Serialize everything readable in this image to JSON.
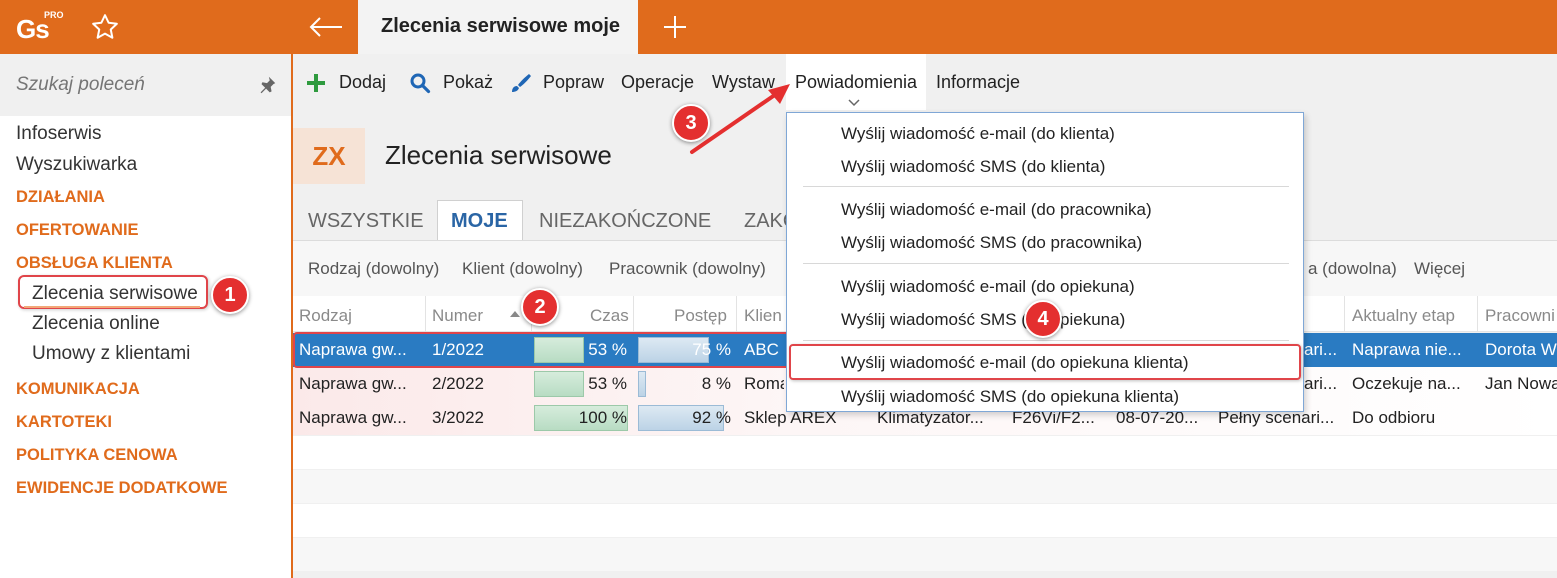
{
  "app": {
    "logo": "Gs",
    "logo_sup": "PRO",
    "window_tab": "Zlecenia serwisowe moje"
  },
  "sidebar": {
    "search_placeholder": "Szukaj poleceń",
    "items": [
      {
        "label": "Infoserwis"
      },
      {
        "label": "Wyszukiwarka"
      }
    ],
    "categories": {
      "dzialania": "DZIAŁANIA",
      "ofertowanie": "OFERTOWANIE",
      "obsluga": "OBSŁUGA KLIENTA",
      "komunikacja": "KOMUNIKACJA",
      "kartoteki": "KARTOTEKI",
      "polityka": "POLITYKA CENOWA",
      "ewidencje": "EWIDENCJE DODATKOWE"
    },
    "sub_items": [
      {
        "label": "Zlecenia serwisowe"
      },
      {
        "label": "Zlecenia online"
      },
      {
        "label": "Umowy z klientami"
      }
    ]
  },
  "toolbar": {
    "add": "Dodaj",
    "show": "Pokaż",
    "edit": "Popraw",
    "operations": "Operacje",
    "issue": "Wystaw",
    "notifications": "Powiadomienia",
    "info": "Informacje"
  },
  "page": {
    "badge": "ZX",
    "title": "Zlecenia serwisowe"
  },
  "view_tabs": [
    "WSZYSTKIE",
    "MOJE",
    "NIEZAKOŃCZONE",
    "ZAKO"
  ],
  "filters": {
    "type": "Rodzaj (dowolny)",
    "client": "Klient (dowolny)",
    "employee": "Pracownik (dowolny)",
    "stage": "a (dowolna)",
    "more": "Więcej"
  },
  "table": {
    "headers": {
      "type": "Rodzaj",
      "number": "Numer",
      "time": "Czas",
      "progress": "Postęp",
      "client": "Klien",
      "stage": "Aktualny etap",
      "employee": "Pracowni"
    },
    "rows": [
      {
        "type": "Naprawa gw...",
        "number": "1/2022",
        "time": "53 %",
        "time_fill": 0.53,
        "progress": "75 %",
        "progress_fill": 0.75,
        "client": "ABC S",
        "c5": "",
        "c6": "",
        "c7": "",
        "scenario": "ari...",
        "stage": "Naprawa nie...",
        "employee": "Dorota W"
      },
      {
        "type": "Naprawa gw...",
        "number": "2/2022",
        "time": "53 %",
        "time_fill": 0.53,
        "progress": "8 %",
        "progress_fill": 0.08,
        "client": "Roma",
        "c5": "",
        "c6": "",
        "c7": "",
        "scenario": "ari...",
        "stage": "Oczekuje na...",
        "employee": "Jan Nowa"
      },
      {
        "type": "Naprawa gw...",
        "number": "3/2022",
        "time": "100 %",
        "time_fill": 1.0,
        "progress": "92 %",
        "progress_fill": 0.92,
        "client": "Sklep AREX",
        "c5": "Klimatyzator...",
        "c6": "F26Vi/F2...",
        "c7": "08-07-20...",
        "scenario": "Pełny scenari...",
        "stage": "Do odbioru",
        "employee": ""
      }
    ]
  },
  "dropdown": {
    "items": [
      "Wyślij wiadomość e-mail (do klienta)",
      "Wyślij wiadomość SMS (do klienta)",
      "Wyślij wiadomość e-mail (do pracownika)",
      "Wyślij wiadomość SMS (do pracownika)",
      "Wyślij wiadomość e-mail (do opiekuna)",
      "Wyślij wiadomość SMS (do opiekuna)",
      "Wyślij wiadomość e-mail (do opiekuna klienta)",
      "Wyślij wiadomość SMS (do opiekuna klienta)"
    ]
  },
  "markers": [
    "1",
    "2",
    "3",
    "4"
  ],
  "colors": {
    "brand": "#e06b1c",
    "selection": "#2a7bc2",
    "highlight": "#e0454a",
    "link_active": "#2a65a5"
  }
}
